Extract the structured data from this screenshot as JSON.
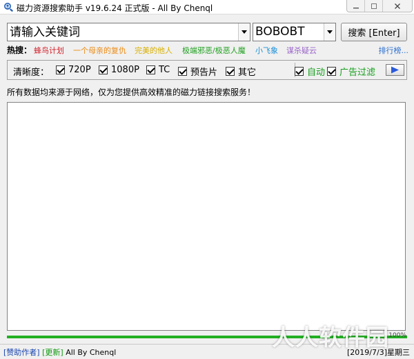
{
  "window": {
    "title": "磁力资源搜索助手 v19.6.24 正式版 - All By Chenql",
    "icon": "magnifier-person-icon"
  },
  "search": {
    "placeholder": "请输入关键词",
    "engine": "BOBOBT",
    "button_label": "搜索 [Enter]"
  },
  "hot": {
    "label": "热搜：",
    "items": [
      {
        "text": "蜂鸟计划",
        "color": "#d2202a"
      },
      {
        "text": "一个母亲的复仇",
        "color": "#ee8a12"
      },
      {
        "text": "完美的他人",
        "color": "#d8b000"
      },
      {
        "text": "极端邪恶/极恶人魔",
        "color": "#1ea01e"
      },
      {
        "text": "小飞象",
        "color": "#1a8fd8"
      },
      {
        "text": "谋杀疑云",
        "color": "#9a66c8"
      }
    ],
    "rank_link": "排行榜...",
    "rank_color": "#2a6fd0"
  },
  "options": {
    "label": "清晰度：",
    "checkboxes": [
      {
        "label": "720P",
        "checked": true
      },
      {
        "label": "1080P",
        "checked": true
      },
      {
        "label": "TC",
        "checked": true
      },
      {
        "label": "预告片",
        "checked": true
      },
      {
        "label": "其它",
        "checked": true
      }
    ],
    "auto_label": "自动",
    "ad_filter_label": "广告过滤",
    "accent_green": "#169e1d",
    "play_color": "#2a5bd8"
  },
  "notice": "所有数据均来源于网络，仅为您提供高效精准的磁力链接搜索服务！",
  "progress": {
    "value": 100,
    "label": "100%",
    "color": "#22b022"
  },
  "status": {
    "sponsor": "[赞助作者]",
    "update": "[更新]",
    "author": "All By Chenql",
    "date": "[2019/7/3]星期三"
  },
  "watermark": "人人软件园"
}
